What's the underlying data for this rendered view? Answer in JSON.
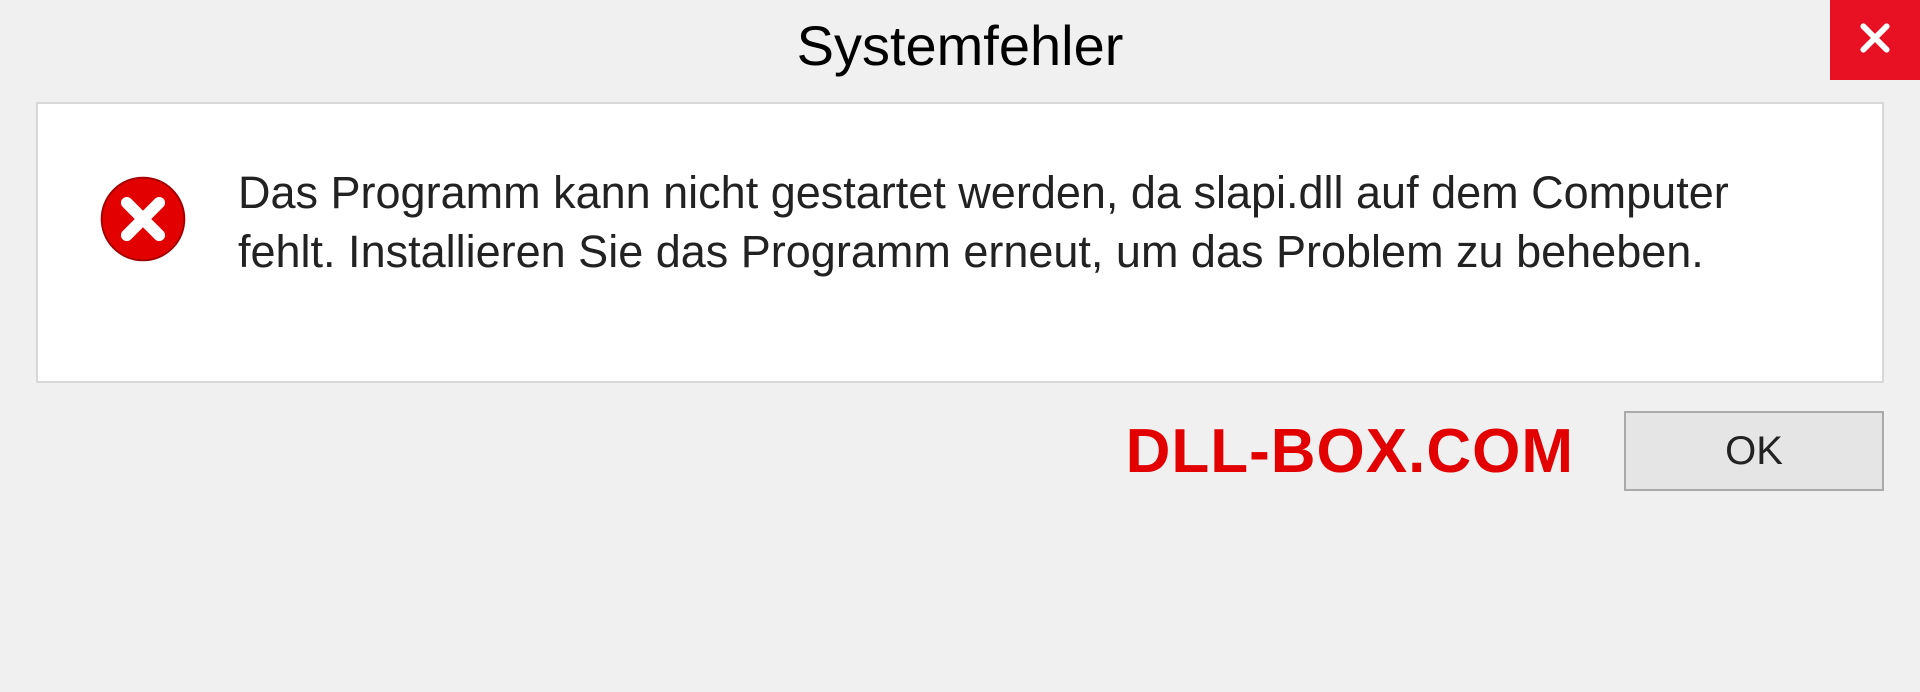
{
  "dialog": {
    "title": "Systemfehler",
    "message": "Das Programm kann nicht gestartet werden, da slapi.dll auf dem Computer fehlt. Installieren Sie das Programm erneut, um das Problem zu beheben.",
    "ok_label": "OK"
  },
  "watermark": "DLL-BOX.COM",
  "colors": {
    "close_bg": "#e81123",
    "error_red": "#e20000"
  }
}
